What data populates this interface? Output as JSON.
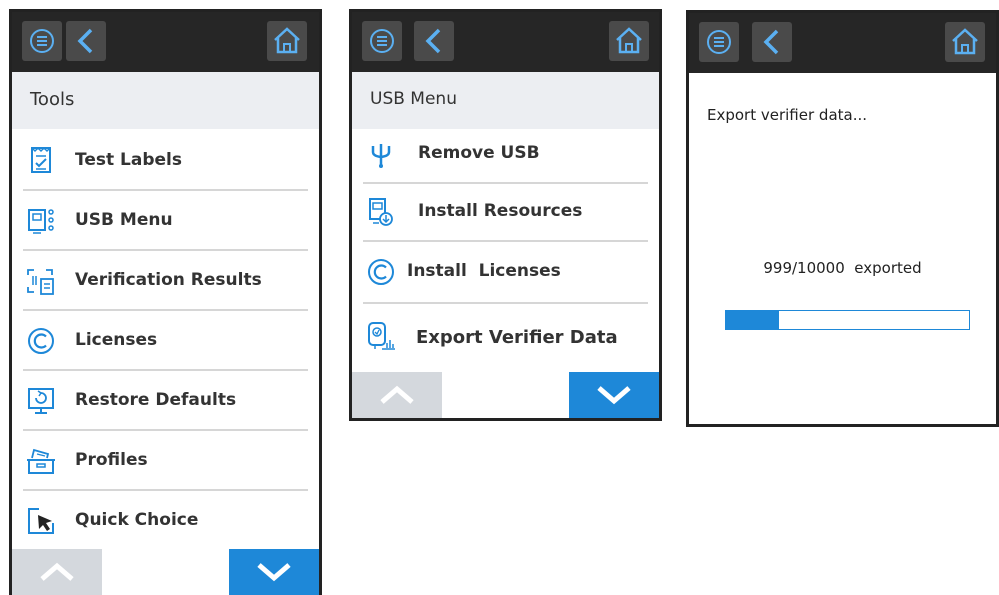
{
  "colors": {
    "accent": "#1e88d8",
    "topbar": "#262626",
    "button": "#4a4a4a",
    "title_bg": "#eceef2",
    "up_button": "#d4d8dd"
  },
  "screens": [
    {
      "title": "Tools",
      "items": [
        {
          "label": "Test Labels",
          "icon": "test-labels-icon"
        },
        {
          "label": "USB Menu",
          "icon": "usb-menu-icon"
        },
        {
          "label": "Verification Results",
          "icon": "verification-results-icon"
        },
        {
          "label": "Licenses",
          "icon": "copyright-icon"
        },
        {
          "label": "Restore Defaults",
          "icon": "restore-defaults-icon"
        },
        {
          "label": "Profiles",
          "icon": "profiles-icon"
        },
        {
          "label": "Quick Choice",
          "icon": "quick-choice-icon"
        }
      ]
    },
    {
      "title": "USB Menu",
      "items": [
        {
          "label": "Remove USB",
          "icon": "usb-icon"
        },
        {
          "label": "Install Resources",
          "icon": "install-resources-icon"
        },
        {
          "label": "Install  Licenses",
          "icon": "copyright-icon"
        },
        {
          "label": "Export Verifier Data",
          "icon": "export-verifier-data-icon"
        }
      ]
    },
    {
      "message": "Export verifier data...",
      "progress_text": "999/10000  exported",
      "progress": {
        "current": 999,
        "total": 10000
      }
    }
  ],
  "icons": {
    "menu": "menu-icon",
    "back": "back-arrow-icon",
    "home": "home-icon",
    "scroll_up": "chevron-up-icon",
    "scroll_down": "chevron-down-icon"
  }
}
